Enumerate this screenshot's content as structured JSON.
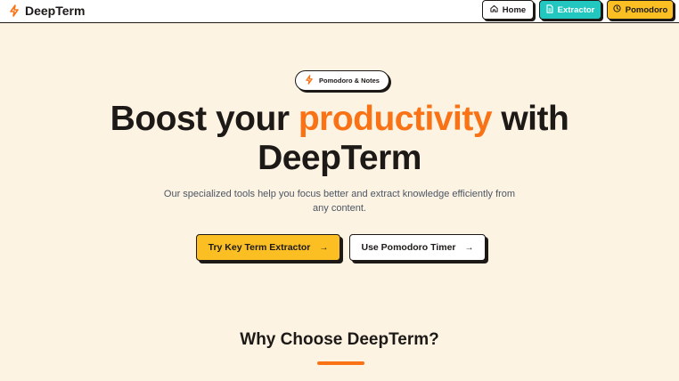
{
  "colors": {
    "background": "#fdf3e3",
    "accent_orange": "#f97316",
    "yellow": "#fbbf24",
    "teal": "#22c7c0",
    "ink": "#1c1917"
  },
  "navbar": {
    "brand": "DeepTerm",
    "brand_icon": "lightning-bolt-icon",
    "links": {
      "home": {
        "label": "Home",
        "icon": "house-icon"
      },
      "extractor": {
        "label": "Extractor",
        "icon": "document-icon"
      },
      "pomodoro": {
        "label": "Pomodoro",
        "icon": "clock-icon"
      }
    }
  },
  "hero": {
    "badge": {
      "label": "Pomodoro & Notes",
      "icon": "lightning-bolt-icon"
    },
    "headline": {
      "part1": "Boost your ",
      "highlight": "productivity",
      "part2": " with",
      "line2": "DeepTerm"
    },
    "subtext": "Our specialized tools help you focus better and extract knowledge efficiently from any content.",
    "primary_cta": "Try Key Term Extractor",
    "secondary_cta": "Use Pomodoro Timer",
    "arrow": "→"
  },
  "why_section": {
    "title": "Why Choose DeepTerm?"
  }
}
